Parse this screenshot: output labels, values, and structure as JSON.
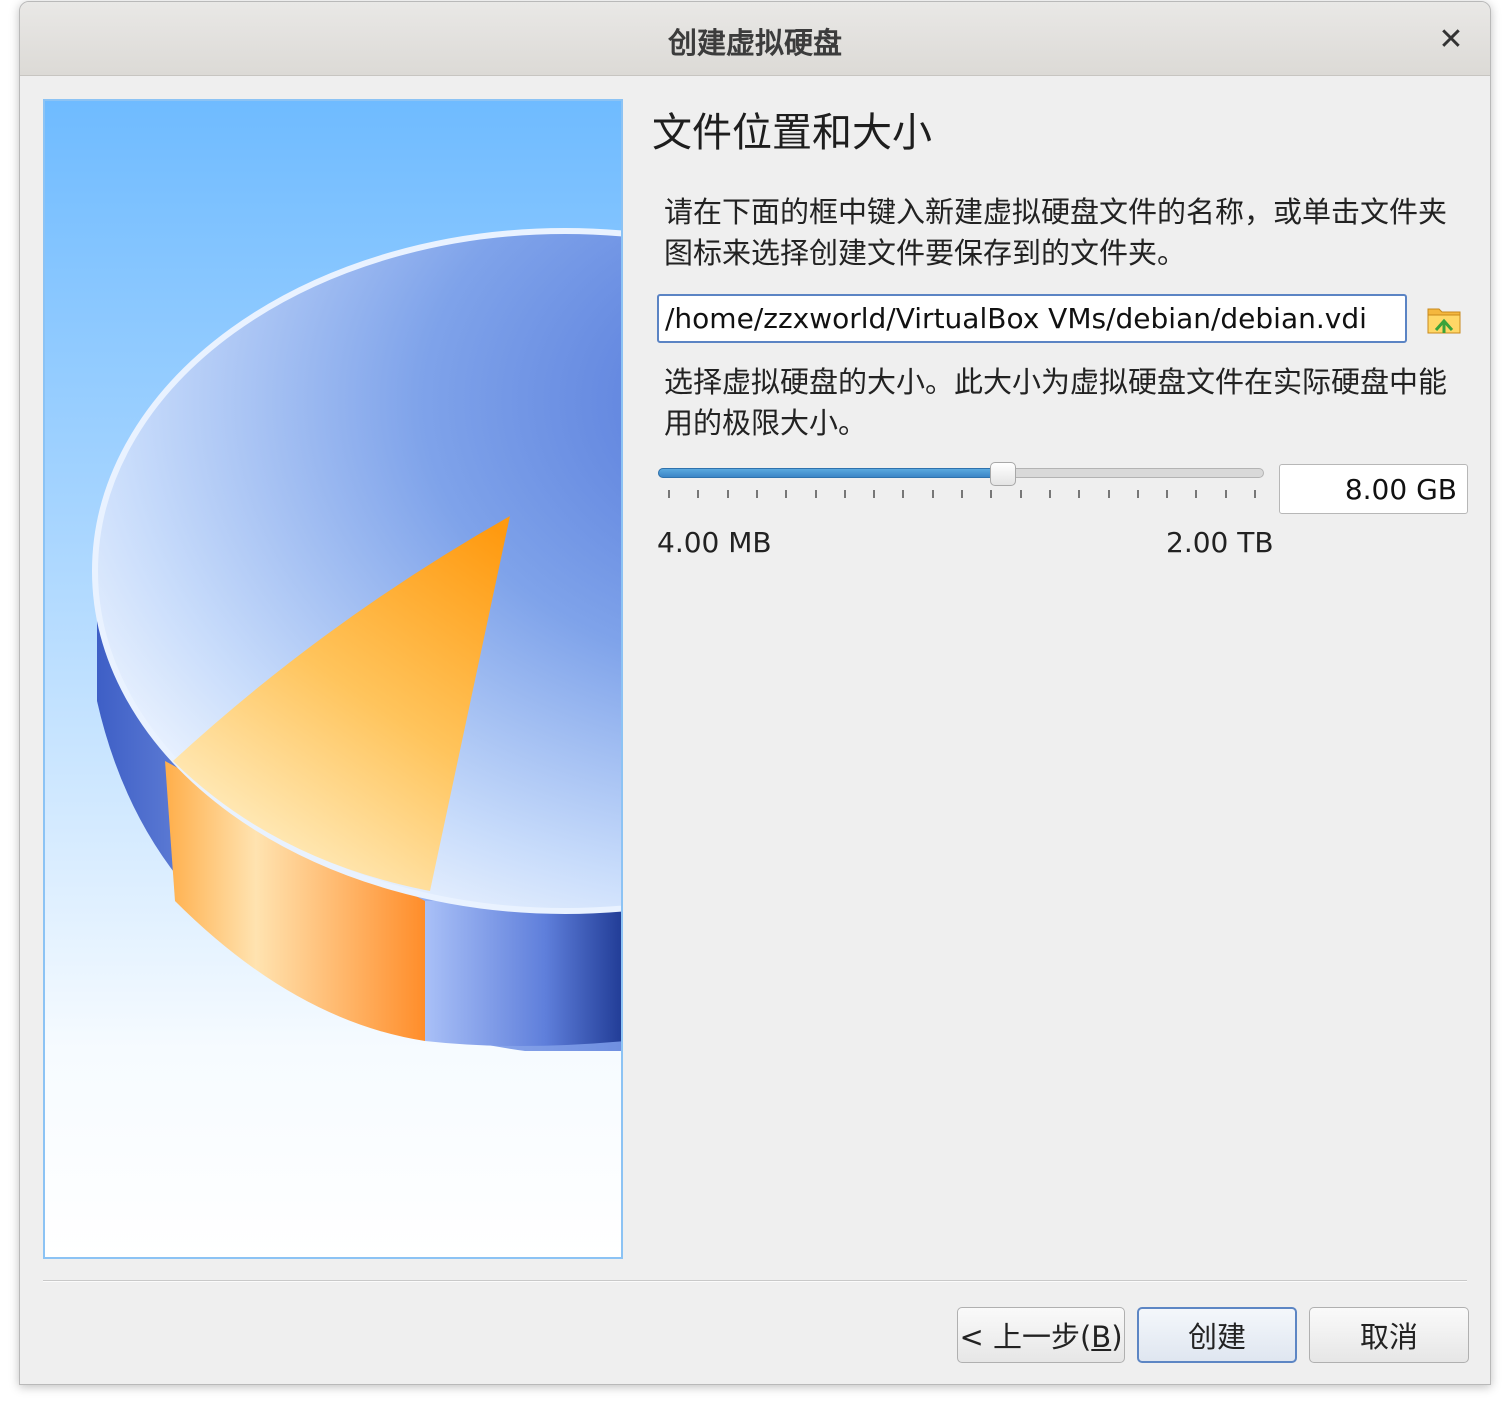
{
  "window": {
    "title": "创建虚拟硬盘",
    "close_icon": "close-icon"
  },
  "page": {
    "heading": "文件位置和大小",
    "location_description": "请在下面的框中键入新建虚拟硬盘文件的名称，或单击文件夹图标来选择创建文件要保存到的文件夹。",
    "file_path": "/home/zzxworld/VirtualBox VMs/debian/debian.vdi",
    "folder_icon": "folder-icon",
    "size_description": "选择虚拟硬盘的大小。此大小为虚拟硬盘文件在实际硬盘中能用的极限大小。",
    "size_value": "8.00 GB",
    "slider_fraction": 0.57,
    "range_min": "4.00 MB",
    "range_max": "2.00 TB"
  },
  "buttons": {
    "back_prefix": "< 上一步(",
    "back_key": "B",
    "back_suffix": ")",
    "create": "创建",
    "cancel": "取消"
  },
  "colors": {
    "accent": "#3b86c6",
    "focus_border": "#5b84c4"
  }
}
